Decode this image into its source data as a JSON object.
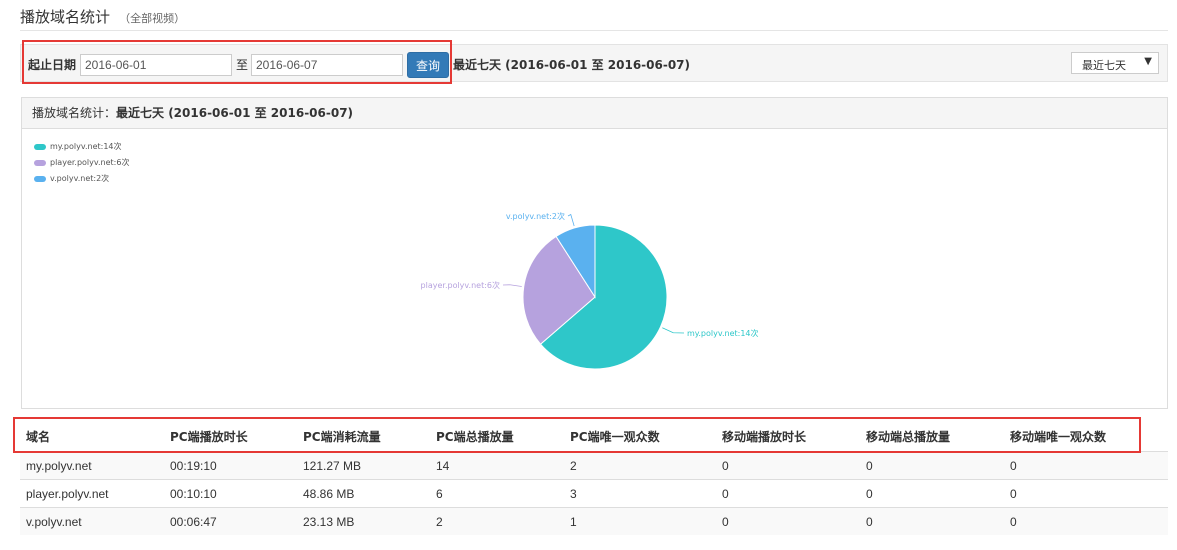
{
  "header": {
    "title": "播放域名统计",
    "subtitle": "（全部视频）"
  },
  "filter": {
    "label": "起止日期",
    "start_date": "2016-06-01",
    "separator": "至",
    "end_date": "2016-06-07",
    "query_label": "查询",
    "range_text": "最近七天 (2016-06-01 至 2016-06-07)",
    "range_select": "最近七天"
  },
  "panel": {
    "title_prefix": "播放域名统计：",
    "title_range": "最近七天 (2016-06-01 至 2016-06-07)"
  },
  "chart_data": {
    "type": "pie",
    "slices": [
      {
        "name": "my.polyv.net",
        "value": 14,
        "label": "my.polyv.net:14次",
        "color": "#2ec7c9"
      },
      {
        "name": "player.polyv.net",
        "value": 6,
        "label": "player.polyv.net:6次",
        "color": "#b6a2de"
      },
      {
        "name": "v.polyv.net",
        "value": 2,
        "label": "v.polyv.net:2次",
        "color": "#5ab1ef"
      }
    ],
    "legend_position": "top-left"
  },
  "table": {
    "headers": [
      "域名",
      "PC端播放时长",
      "PC端消耗流量",
      "PC端总播放量",
      "PC端唯一观众数",
      "移动端播放时长",
      "移动端总播放量",
      "移动端唯一观众数"
    ],
    "rows": [
      [
        "my.polyv.net",
        "00:19:10",
        "121.27 MB",
        "14",
        "2",
        "0",
        "0",
        "0"
      ],
      [
        "player.polyv.net",
        "00:10:10",
        "48.86 MB",
        "6",
        "3",
        "0",
        "0",
        "0"
      ],
      [
        "v.polyv.net",
        "00:06:47",
        "23.13 MB",
        "2",
        "1",
        "0",
        "0",
        "0"
      ]
    ]
  }
}
